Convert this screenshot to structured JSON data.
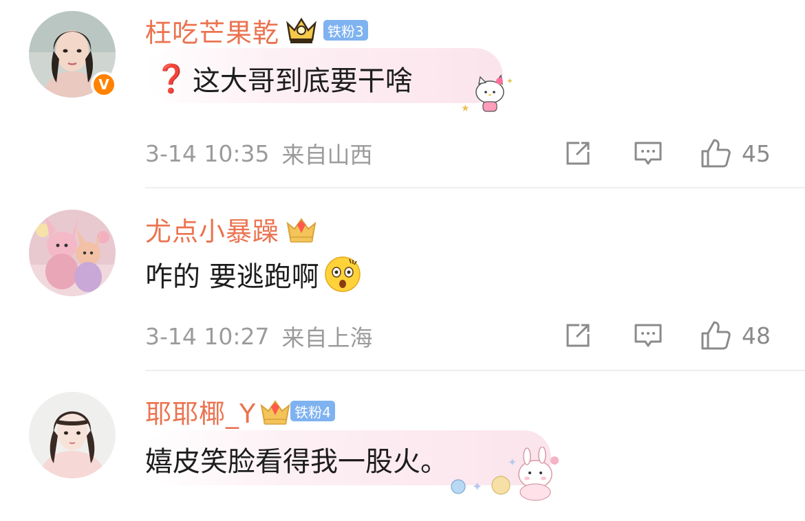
{
  "comments": [
    {
      "username": "枉吃芒果乾",
      "fan_badge": "铁粉3",
      "text": "这大哥到底要干啥",
      "time": "3-14 10:35",
      "location": "来自山西",
      "likes": "45",
      "verified_badge": "V"
    },
    {
      "username": "尤点小暴躁",
      "fan_badge": "",
      "text": "咋的 要逃跑啊",
      "time": "3-14 10:27",
      "location": "来自上海",
      "likes": "48"
    },
    {
      "username": "耶耶椰_Y",
      "fan_badge": "铁粉4",
      "text": "嬉皮笑脸看得我一股火。",
      "time": "",
      "location": "",
      "likes": ""
    }
  ],
  "icons": {
    "question": "❓",
    "share": "share-icon",
    "comment": "comment-icon",
    "like": "thumbs-up-icon"
  },
  "colors": {
    "username": "#eb7350",
    "meta": "#9b9b9b",
    "verified": "#ff8200",
    "fan_badge": "#7fb2f0"
  }
}
